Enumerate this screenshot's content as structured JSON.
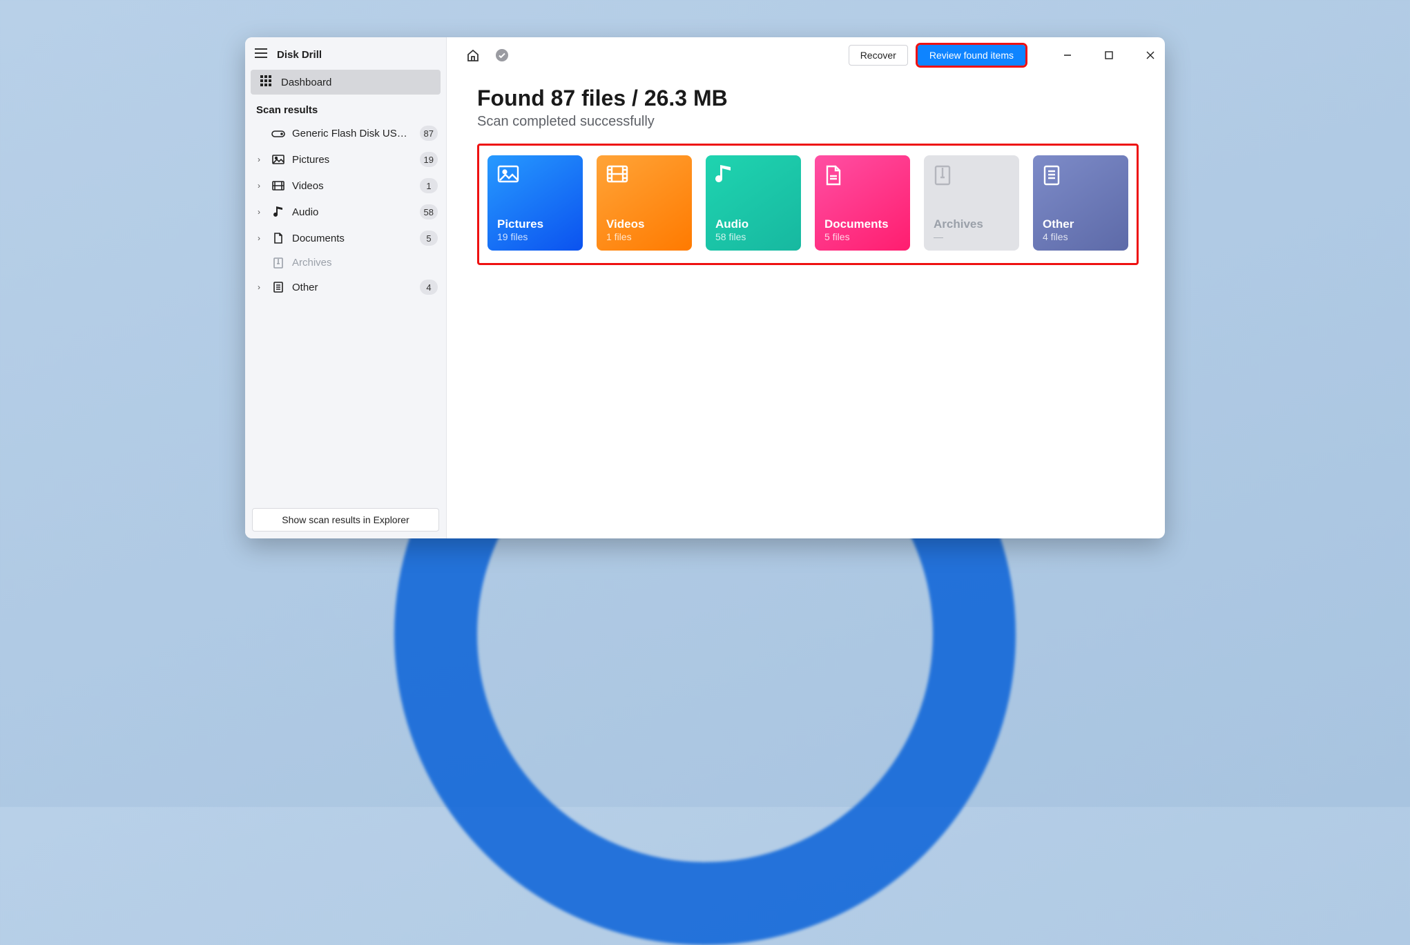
{
  "app": {
    "title": "Disk Drill"
  },
  "sidebar": {
    "dashboard_label": "Dashboard",
    "section_label": "Scan results",
    "device": {
      "label": "Generic Flash Disk USB D…",
      "count": "87"
    },
    "items": [
      {
        "key": "pictures",
        "label": "Pictures",
        "count": "19"
      },
      {
        "key": "videos",
        "label": "Videos",
        "count": "1"
      },
      {
        "key": "audio",
        "label": "Audio",
        "count": "58"
      },
      {
        "key": "documents",
        "label": "Documents",
        "count": "5"
      },
      {
        "key": "archives",
        "label": "Archives",
        "count": ""
      },
      {
        "key": "other",
        "label": "Other",
        "count": "4"
      }
    ],
    "footer_button": "Show scan results in Explorer"
  },
  "topbar": {
    "recover_label": "Recover",
    "review_label": "Review found items"
  },
  "summary": {
    "heading": "Found 87 files / 26.3 MB",
    "subheading": "Scan completed successfully"
  },
  "tiles": [
    {
      "key": "pictures",
      "label": "Pictures",
      "count": "19 files"
    },
    {
      "key": "videos",
      "label": "Videos",
      "count": "1 files"
    },
    {
      "key": "audio",
      "label": "Audio",
      "count": "58 files"
    },
    {
      "key": "documents",
      "label": "Documents",
      "count": "5 files"
    },
    {
      "key": "archives",
      "label": "Archives",
      "count": "—"
    },
    {
      "key": "other",
      "label": "Other",
      "count": "4 files"
    }
  ]
}
